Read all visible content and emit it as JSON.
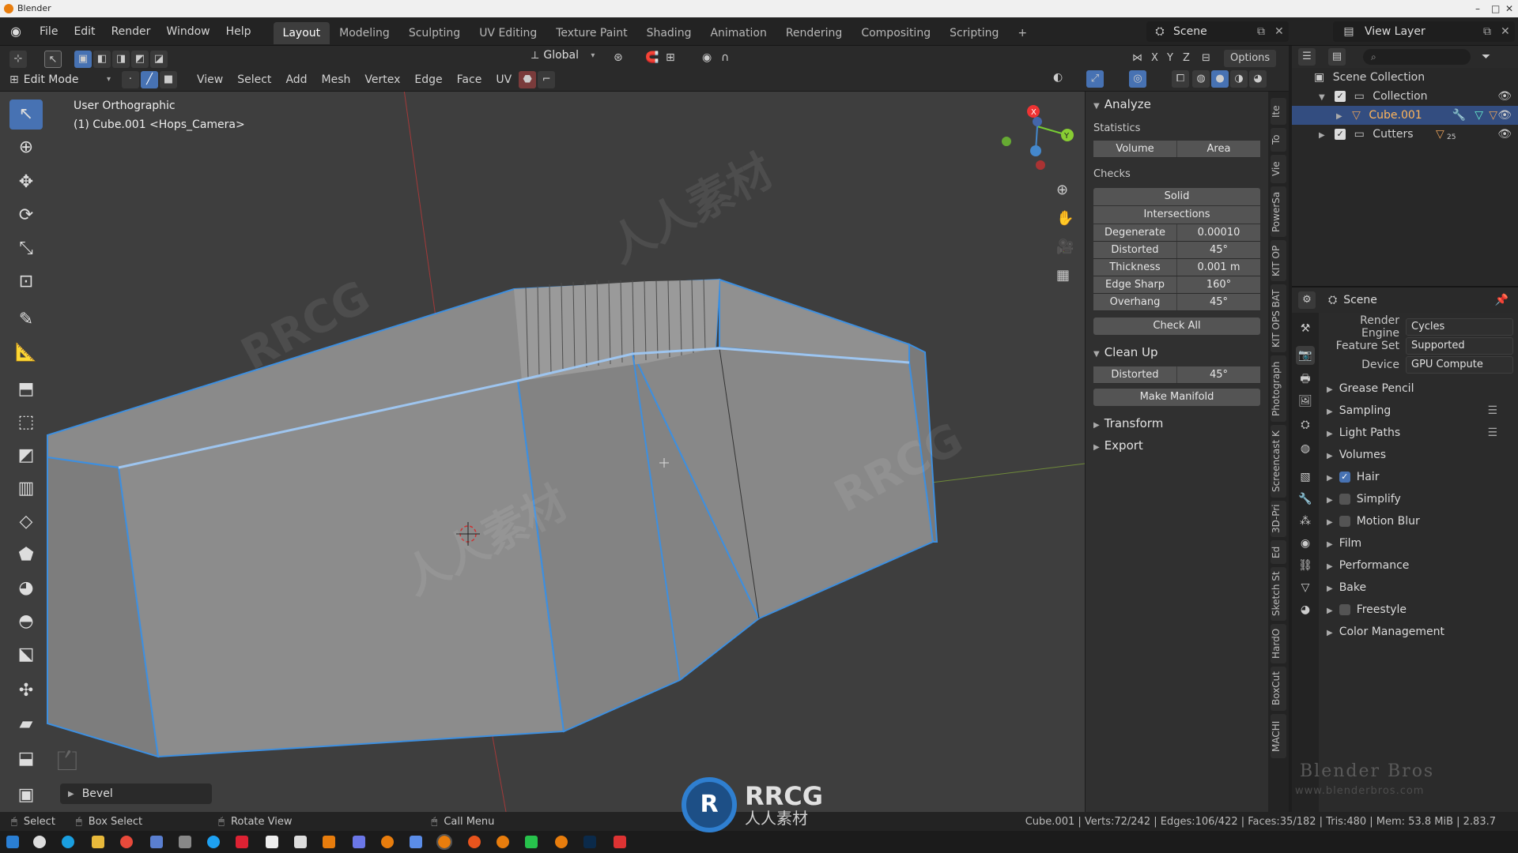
{
  "app": {
    "title": "Blender"
  },
  "menu": [
    "File",
    "Edit",
    "Render",
    "Window",
    "Help"
  ],
  "workspaces": [
    "Layout",
    "Modeling",
    "Sculpting",
    "UV Editing",
    "Texture Paint",
    "Shading",
    "Animation",
    "Rendering",
    "Compositing",
    "Scripting"
  ],
  "active_workspace": "Layout",
  "scene": {
    "label": "Scene",
    "view_layer": "View Layer"
  },
  "viewport_header": {
    "transform_orientation": "Global",
    "options": "Options",
    "axes": [
      "X",
      "Y",
      "Z"
    ],
    "mode": "Edit Mode",
    "menus": [
      "View",
      "Select",
      "Add",
      "Mesh",
      "Vertex",
      "Edge",
      "Face",
      "UV"
    ]
  },
  "viewport": {
    "view_name": "User Orthographic",
    "object_info": "(1) Cube.001 <Hops_Camera>",
    "last_operator": "Bevel",
    "gizmo_axes": [
      "X",
      "Y"
    ]
  },
  "npanel": {
    "analyze": {
      "title": "Analyze",
      "statistics_label": "Statistics",
      "statistics_buttons": [
        "Volume",
        "Area"
      ],
      "checks_label": "Checks",
      "solid": "Solid",
      "intersections": "Intersections",
      "checks": [
        {
          "label": "Degenerate",
          "value": "0.00010"
        },
        {
          "label": "Distorted",
          "value": "45°"
        },
        {
          "label": "Thickness",
          "value": "0.001 m"
        },
        {
          "label": "Edge Sharp",
          "value": "160°"
        },
        {
          "label": "Overhang",
          "value": "45°"
        }
      ],
      "check_all": "Check All"
    },
    "cleanup": {
      "title": "Clean Up",
      "distorted_label": "Distorted",
      "distorted_value": "45°",
      "make_manifold": "Make Manifold"
    },
    "transform": "Transform",
    "export": "Export"
  },
  "side_tabs": [
    "Ite",
    "To",
    "Vie",
    "PowerSa",
    "KIT OP",
    "KIT OPS BAT",
    "Photograph",
    "Screencast K",
    "3D-Pri",
    "Ed",
    "Sketch St",
    "HardO",
    "BoxCut",
    "MACHI"
  ],
  "outliner": {
    "root": "Scene Collection",
    "items": [
      {
        "name": "Collection",
        "indent": 1
      },
      {
        "name": "Cube.001",
        "indent": 2,
        "selected": true
      },
      {
        "name": "Cutters",
        "indent": 1,
        "badge": "25"
      }
    ]
  },
  "properties": {
    "context": "Scene",
    "rows": [
      {
        "label": "Render Engine",
        "value": "Cycles"
      },
      {
        "label": "Feature Set",
        "value": "Supported"
      },
      {
        "label": "Device",
        "value": "GPU Compute"
      }
    ],
    "sections": [
      {
        "label": "Grease Pencil"
      },
      {
        "label": "Sampling"
      },
      {
        "label": "Light Paths"
      },
      {
        "label": "Volumes"
      },
      {
        "label": "Hair",
        "checkbox": true,
        "checked": true
      },
      {
        "label": "Simplify",
        "checkbox": true,
        "checked": false
      },
      {
        "label": "Motion Blur",
        "checkbox": true,
        "checked": false
      },
      {
        "label": "Film"
      },
      {
        "label": "Performance"
      },
      {
        "label": "Bake"
      },
      {
        "label": "Freestyle",
        "checkbox": true,
        "checked": false
      },
      {
        "label": "Color Management"
      }
    ]
  },
  "statusbar": {
    "select": "Select",
    "box_select": "Box Select",
    "rotate_view": "Rotate View",
    "call_menu": "Call Menu",
    "stats": "Cube.001 | Verts:72/242 | Edges:106/422 | Faces:35/182 | Tris:480 | Mem: 53.8 MiB | 2.83.7"
  },
  "watermarks": {
    "brand": "Blender Bros",
    "url": "www.blenderbros.com",
    "rrcg": "RRCG",
    "rrcg_cn": "人人素材"
  },
  "colors": {
    "accent": "#4772b3",
    "selection": "#3d8fe0",
    "mesh_face": "#8c8c8c",
    "viewport_bg": "#3e3e3e"
  }
}
